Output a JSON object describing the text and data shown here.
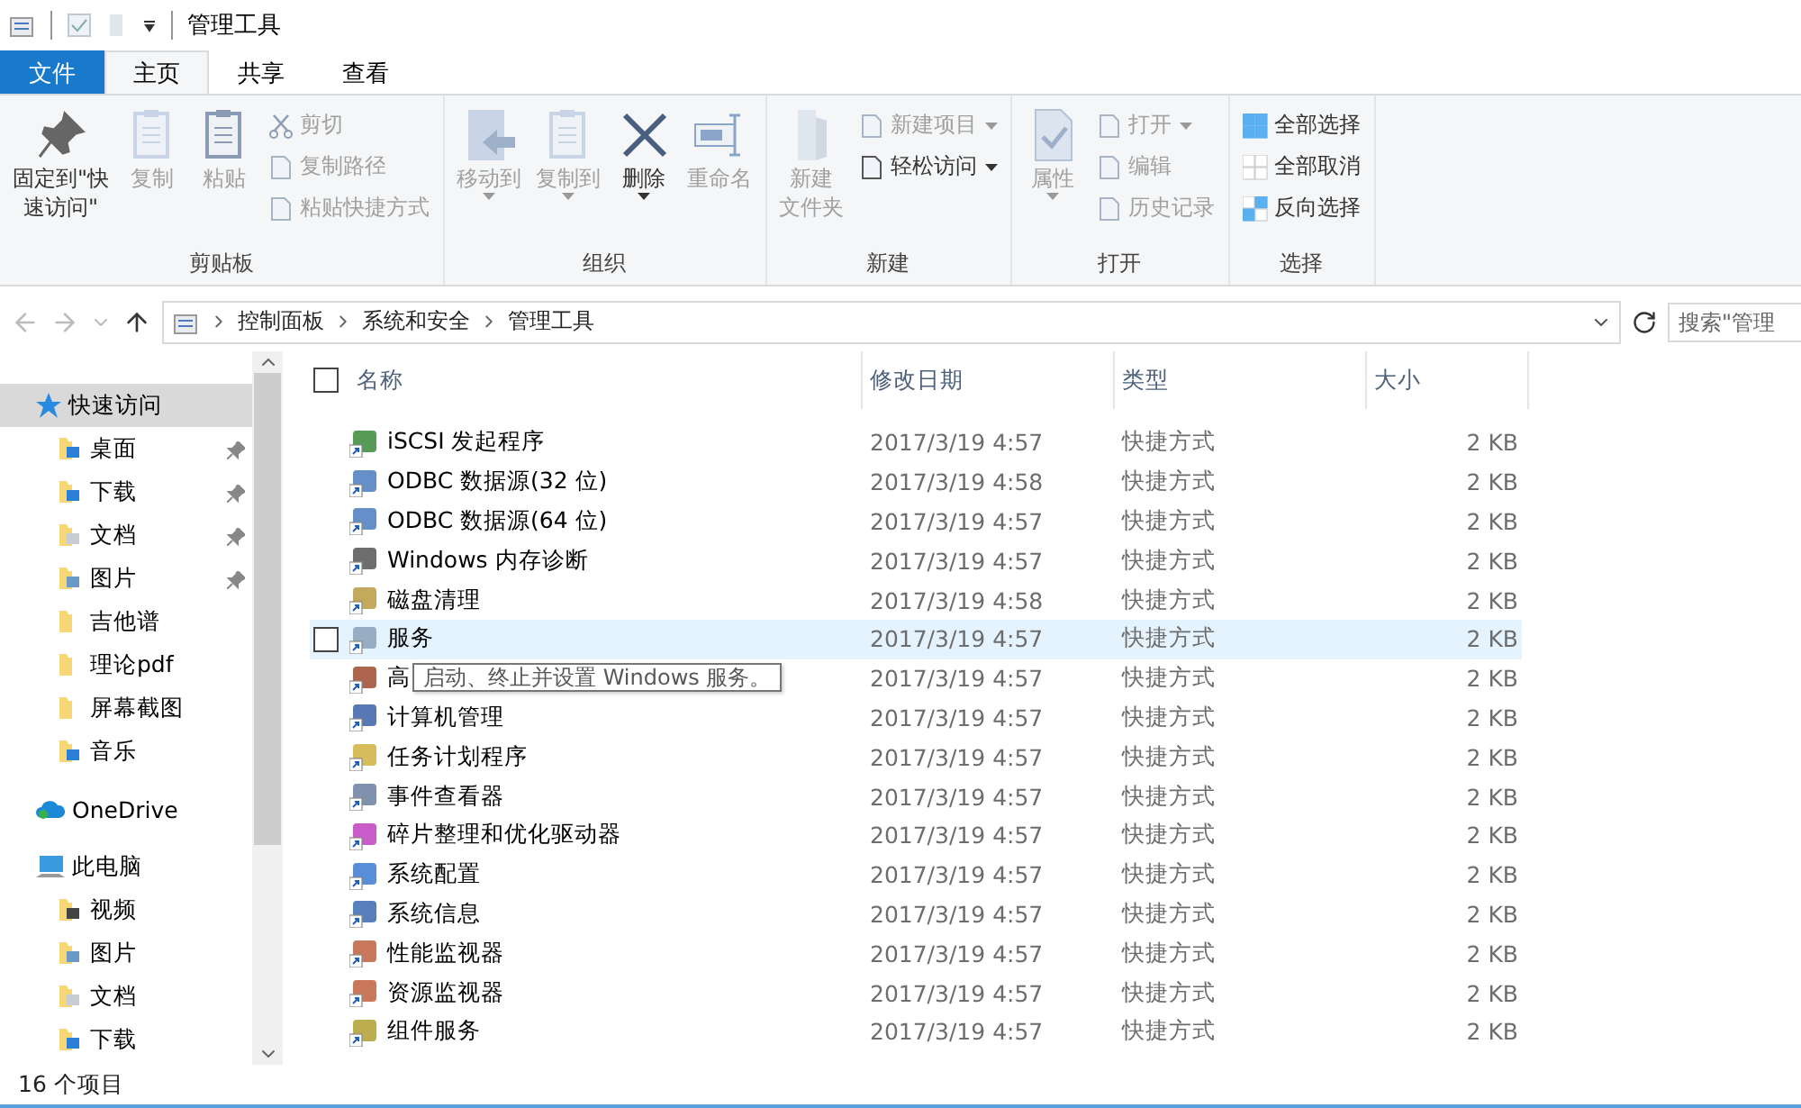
{
  "window": {
    "title": "管理工具"
  },
  "tabs": [
    {
      "label": "文件",
      "kind": "file",
      "selected": false
    },
    {
      "label": "主页",
      "kind": "tab",
      "selected": true
    },
    {
      "label": "共享",
      "kind": "tab",
      "selected": false
    },
    {
      "label": "查看",
      "kind": "tab",
      "selected": false
    }
  ],
  "ribbon": [
    {
      "label": "剪贴板",
      "items": [
        {
          "label": "固定到\"快速访问\"",
          "kind": "large",
          "disabled": false,
          "dropdown": false
        },
        {
          "label": "复制",
          "kind": "large",
          "disabled": true,
          "dropdown": false
        },
        {
          "label": "粘贴",
          "kind": "large",
          "disabled": true,
          "dropdown": false
        },
        {
          "kind": "stack",
          "items": [
            {
              "label": "剪切",
              "disabled": true,
              "dropdown": false
            },
            {
              "label": "复制路径",
              "disabled": true,
              "dropdown": false
            },
            {
              "label": "粘贴快捷方式",
              "disabled": true,
              "dropdown": false
            }
          ]
        }
      ]
    },
    {
      "label": "组织",
      "items": [
        {
          "label": "移动到",
          "kind": "large",
          "disabled": true,
          "dropdown": true
        },
        {
          "label": "复制到",
          "kind": "large",
          "disabled": true,
          "dropdown": true
        },
        {
          "label": "删除",
          "kind": "large",
          "disabled": false,
          "dropdown": true
        },
        {
          "label": "重命名",
          "kind": "large",
          "disabled": true,
          "dropdown": false
        }
      ]
    },
    {
      "label": "新建",
      "items": [
        {
          "label": "新建文件夹",
          "kind": "large",
          "disabled": true,
          "dropdown": false
        },
        {
          "kind": "stack",
          "items": [
            {
              "label": "新建项目",
              "disabled": true,
              "dropdown": true
            },
            {
              "label": "轻松访问",
              "disabled": false,
              "dropdown": true
            }
          ]
        }
      ]
    },
    {
      "label": "打开",
      "items": [
        {
          "label": "属性",
          "kind": "large",
          "disabled": true,
          "dropdown": true
        },
        {
          "kind": "stack",
          "items": [
            {
              "label": "打开",
              "disabled": true,
              "dropdown": true
            },
            {
              "label": "编辑",
              "disabled": true,
              "dropdown": false
            },
            {
              "label": "历史记录",
              "disabled": true,
              "dropdown": false
            }
          ]
        }
      ]
    },
    {
      "label": "选择",
      "items": [
        {
          "kind": "stack",
          "items": [
            {
              "label": "全部选择",
              "disabled": false,
              "dropdown": false
            },
            {
              "label": "全部取消",
              "disabled": false,
              "dropdown": false
            },
            {
              "label": "反向选择",
              "disabled": false,
              "dropdown": false
            }
          ]
        }
      ]
    }
  ],
  "address": {
    "crumbs": [
      "控制面板",
      "系统和安全",
      "管理工具"
    ],
    "search_placeholder": "搜索\"管理"
  },
  "sidebar": [
    {
      "label": "快速访问",
      "selected": true,
      "children": [
        {
          "label": "桌面",
          "pinned": true
        },
        {
          "label": "下载",
          "pinned": true
        },
        {
          "label": "文档",
          "pinned": true
        },
        {
          "label": "图片",
          "pinned": true
        },
        {
          "label": "吉他谱",
          "pinned": false
        },
        {
          "label": "理论pdf",
          "pinned": false
        },
        {
          "label": "屏幕截图",
          "pinned": false
        },
        {
          "label": "音乐",
          "pinned": false
        }
      ]
    },
    {
      "label": "OneDrive",
      "selected": false
    },
    {
      "label": "此电脑",
      "selected": false,
      "children": [
        {
          "label": "视频",
          "pinned": false
        },
        {
          "label": "图片",
          "pinned": false
        },
        {
          "label": "文档",
          "pinned": false
        },
        {
          "label": "下载",
          "pinned": false
        }
      ]
    }
  ],
  "table": {
    "select_all_checked": false,
    "columns": [
      "名称",
      "修改日期",
      "类型",
      "大小"
    ],
    "rows": [
      {
        "name": "iSCSI 发起程序",
        "date": "2017/3/19 4:57",
        "type": "快捷方式",
        "size": "2 KB",
        "hovered": false
      },
      {
        "name": "ODBC 数据源(32 位)",
        "date": "2017/3/19 4:58",
        "type": "快捷方式",
        "size": "2 KB",
        "hovered": false
      },
      {
        "name": "ODBC 数据源(64 位)",
        "date": "2017/3/19 4:57",
        "type": "快捷方式",
        "size": "2 KB",
        "hovered": false
      },
      {
        "name": "Windows 内存诊断",
        "date": "2017/3/19 4:57",
        "type": "快捷方式",
        "size": "2 KB",
        "hovered": false
      },
      {
        "name": "磁盘清理",
        "date": "2017/3/19 4:58",
        "type": "快捷方式",
        "size": "2 KB",
        "hovered": false
      },
      {
        "name": "服务",
        "date": "2017/3/19 4:57",
        "type": "快捷方式",
        "size": "2 KB",
        "hovered": true,
        "tooltip": "启动、终止并设置 Windows 服务。"
      },
      {
        "name": "高",
        "date": "2017/3/19 4:57",
        "type": "快捷方式",
        "size": "2 KB",
        "hovered": false
      },
      {
        "name": "计算机管理",
        "date": "2017/3/19 4:57",
        "type": "快捷方式",
        "size": "2 KB",
        "hovered": false
      },
      {
        "name": "任务计划程序",
        "date": "2017/3/19 4:57",
        "type": "快捷方式",
        "size": "2 KB",
        "hovered": false
      },
      {
        "name": "事件查看器",
        "date": "2017/3/19 4:57",
        "type": "快捷方式",
        "size": "2 KB",
        "hovered": false
      },
      {
        "name": "碎片整理和优化驱动器",
        "date": "2017/3/19 4:57",
        "type": "快捷方式",
        "size": "2 KB",
        "hovered": false
      },
      {
        "name": "系统配置",
        "date": "2017/3/19 4:57",
        "type": "快捷方式",
        "size": "2 KB",
        "hovered": false
      },
      {
        "name": "系统信息",
        "date": "2017/3/19 4:57",
        "type": "快捷方式",
        "size": "2 KB",
        "hovered": false
      },
      {
        "name": "性能监视器",
        "date": "2017/3/19 4:57",
        "type": "快捷方式",
        "size": "2 KB",
        "hovered": false
      },
      {
        "name": "资源监视器",
        "date": "2017/3/19 4:57",
        "type": "快捷方式",
        "size": "2 KB",
        "hovered": false
      },
      {
        "name": "组件服务",
        "date": "2017/3/19 4:57",
        "type": "快捷方式",
        "size": "2 KB",
        "hovered": false
      }
    ]
  },
  "status_bar": "16 个项目"
}
